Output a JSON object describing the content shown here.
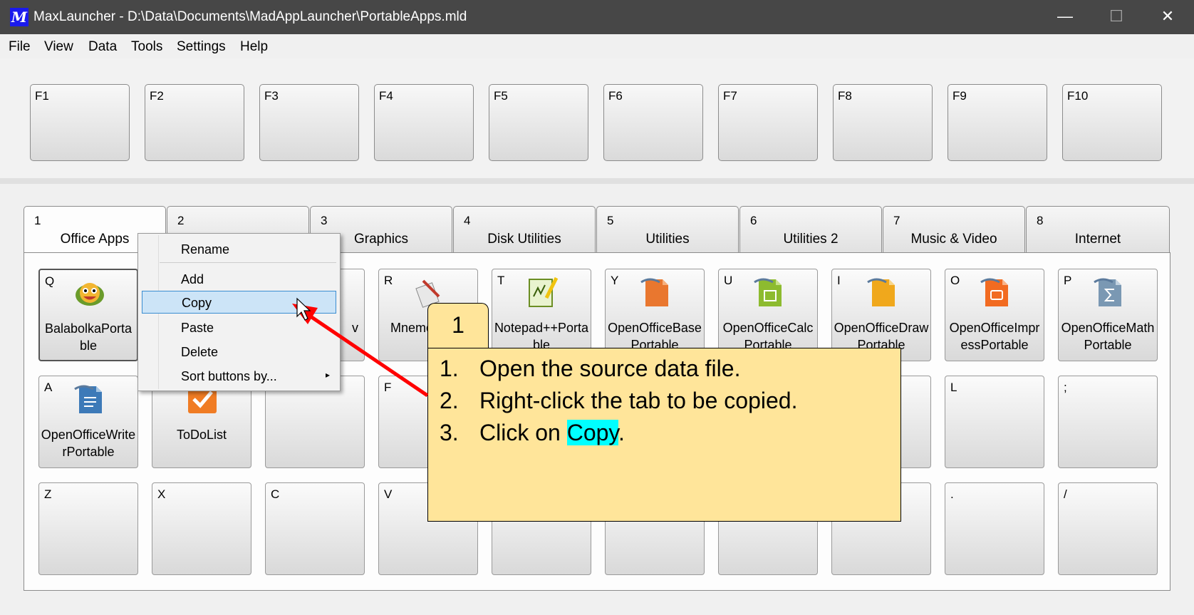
{
  "window": {
    "title": "MaxLauncher - D:\\Data\\Documents\\MadAppLauncher\\PortableApps.mld",
    "min_glyph": "—",
    "max_glyph": "☐",
    "close_glyph": "✕",
    "app_icon_text": "M"
  },
  "menu": [
    "File",
    "View",
    "Data",
    "Tools",
    "Settings",
    "Help"
  ],
  "fkeys": [
    "F1",
    "F2",
    "F3",
    "F4",
    "F5",
    "F6",
    "F7",
    "F8",
    "F9",
    "F10"
  ],
  "tabs": [
    {
      "num": "1",
      "label": "Office Apps"
    },
    {
      "num": "2",
      "label": ""
    },
    {
      "num": "3",
      "label": "Graphics"
    },
    {
      "num": "4",
      "label": "Disk Utilities"
    },
    {
      "num": "5",
      "label": "Utilities"
    },
    {
      "num": "6",
      "label": "Utilities 2"
    },
    {
      "num": "7",
      "label": "Music & Video"
    },
    {
      "num": "8",
      "label": "Internet"
    }
  ],
  "grid": {
    "row1": [
      {
        "key": "Q",
        "label": "BalabolkaPortable",
        "icon": "balabolka-icon"
      },
      {
        "key": "",
        "label": "",
        "icon": ""
      },
      {
        "key": "",
        "label": "v",
        "icon": ""
      },
      {
        "key": "R",
        "label": "Mnemo ortab",
        "icon": "mnemo-icon"
      },
      {
        "key": "T",
        "label": "Notepad++Portable",
        "icon": "notepad-icon"
      },
      {
        "key": "Y",
        "label": "OpenOfficeBasePortable",
        "icon": "ooo-base-icon"
      },
      {
        "key": "U",
        "label": "OpenOfficeCalcPortable",
        "icon": "ooo-calc-icon"
      },
      {
        "key": "I",
        "label": "OpenOfficeDrawPortable",
        "icon": "ooo-draw-icon"
      },
      {
        "key": "O",
        "label": "OpenOfficeImpressPortable",
        "icon": "ooo-impress-icon"
      },
      {
        "key": "P",
        "label": "OpenOfficeMathPortable",
        "icon": "ooo-math-icon"
      }
    ],
    "row2": [
      {
        "key": "A",
        "label": "OpenOfficeWriterPortable",
        "icon": "ooo-writer-icon"
      },
      {
        "key": "",
        "label": "ToDoList",
        "icon": "todolist-icon"
      },
      {
        "key": "",
        "label": "",
        "icon": ""
      },
      {
        "key": "F",
        "label": "",
        "icon": ""
      },
      {
        "key": "",
        "label": "",
        "icon": ""
      },
      {
        "key": "",
        "label": "",
        "icon": ""
      },
      {
        "key": "",
        "label": "",
        "icon": ""
      },
      {
        "key": "",
        "label": "",
        "icon": ""
      },
      {
        "key": "L",
        "label": "",
        "icon": ""
      },
      {
        "key": ";",
        "label": "",
        "icon": ""
      }
    ],
    "row3": [
      {
        "key": "Z",
        "label": "",
        "icon": ""
      },
      {
        "key": "X",
        "label": "",
        "icon": ""
      },
      {
        "key": "C",
        "label": "",
        "icon": ""
      },
      {
        "key": "V",
        "label": "",
        "icon": ""
      },
      {
        "key": "",
        "label": "",
        "icon": ""
      },
      {
        "key": "",
        "label": "",
        "icon": ""
      },
      {
        "key": "",
        "label": "",
        "icon": ""
      },
      {
        "key": "",
        "label": "",
        "icon": ""
      },
      {
        "key": ".",
        "label": "",
        "icon": ""
      },
      {
        "key": "/",
        "label": "",
        "icon": ""
      }
    ]
  },
  "context_menu": {
    "items": [
      "Rename",
      "Add",
      "Copy",
      "Paste",
      "Delete",
      "Sort buttons by..."
    ],
    "highlighted": "Copy",
    "submenu_glyph": "▸"
  },
  "callout": {
    "number": "1",
    "steps": [
      {
        "n": "1.",
        "text": "Open the source data file."
      },
      {
        "n": "2.",
        "text": "Right-click the tab to be copied."
      },
      {
        "n": "3.",
        "pre": "Click on ",
        "hl": "Copy",
        "post": "."
      }
    ]
  },
  "colors": {
    "titlebar": "#474747",
    "callout_fill": "#ffe59a",
    "highlight_copy": "#00ffff",
    "arrow": "#ff0000",
    "menu_highlight": "#cce4f7"
  }
}
